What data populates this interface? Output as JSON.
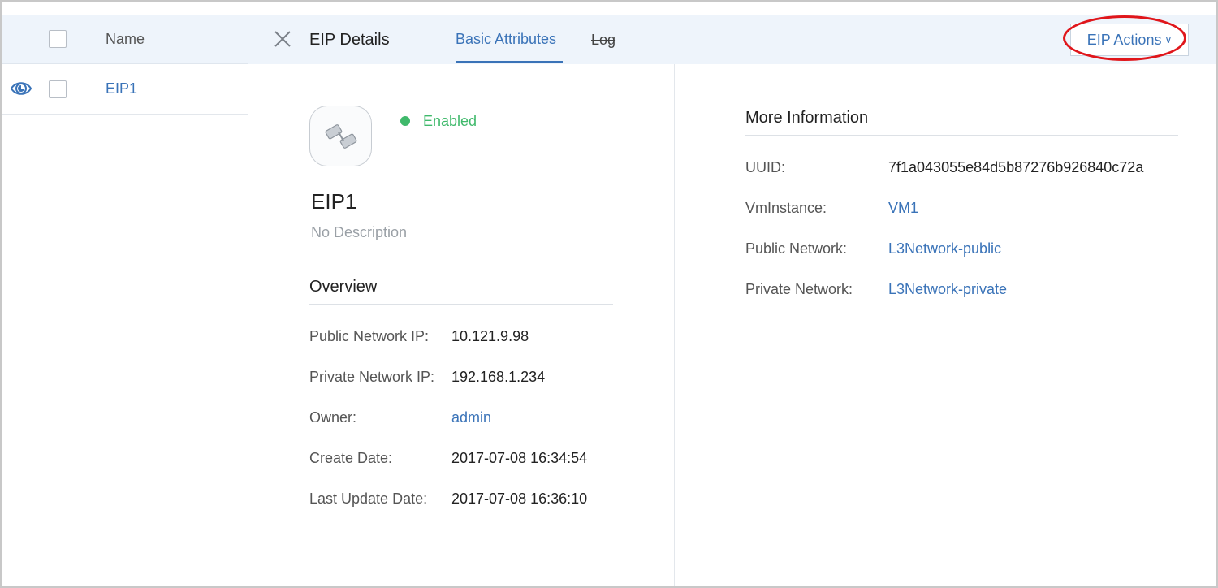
{
  "list": {
    "header": {
      "name_label": "Name"
    },
    "rows": [
      {
        "name": "EIP1"
      }
    ]
  },
  "detail": {
    "title": "EIP Details",
    "tabs": [
      {
        "label": "Basic Attributes",
        "active": true
      },
      {
        "label": "Log",
        "active": false
      }
    ],
    "actions_label": "EIP Actions"
  },
  "summary": {
    "status": "Enabled",
    "name": "EIP1",
    "description": "No Description"
  },
  "overview": {
    "title": "Overview",
    "fields": [
      {
        "label": "Public Network IP:",
        "value": "10.121.9.98"
      },
      {
        "label": "Private Network IP:",
        "value": "192.168.1.234"
      },
      {
        "label": "Owner:",
        "value": "admin"
      },
      {
        "label": "Create Date:",
        "value": "2017-07-08 16:34:54"
      },
      {
        "label": "Last Update Date:",
        "value": "2017-07-08 16:36:10"
      }
    ]
  },
  "more_info": {
    "title": "More Information",
    "fields": [
      {
        "label": "UUID:",
        "value": "7f1a043055e84d5b87276b926840c72a"
      },
      {
        "label": "VmInstance:",
        "value": "VM1"
      },
      {
        "label": "Public Network:",
        "value": "L3Network-public"
      },
      {
        "label": "Private Network:",
        "value": "L3Network-private"
      }
    ]
  },
  "colors": {
    "accent": "#3a73b8",
    "status_enabled": "#3fb96b",
    "highlight_annotation": "#e0161b",
    "header_background": "#eef4fb"
  },
  "icons": {
    "row_view": "eye-icon",
    "close": "close-icon",
    "eip": "eip-link-icon",
    "actions": "chevron-down-icon"
  }
}
